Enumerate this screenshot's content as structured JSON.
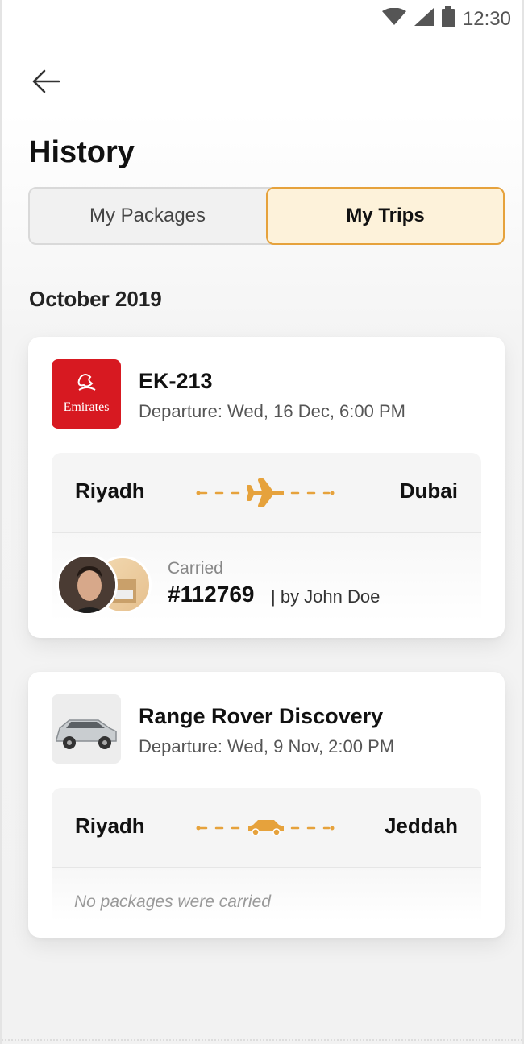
{
  "status_bar": {
    "time": "12:30",
    "icons": [
      "wifi-icon",
      "signal-icon",
      "battery-icon"
    ]
  },
  "header": {
    "back_icon": "arrow-left-icon",
    "title": "History"
  },
  "tabs": [
    {
      "label": "My Packages",
      "active": false
    },
    {
      "label": "My Trips",
      "active": true
    }
  ],
  "section": {
    "month": "October 2019"
  },
  "trips": [
    {
      "kind": "flight",
      "thumbnail": "emirates-logo",
      "logo_text": "Emirates",
      "title": "EK-213",
      "departure": "Departure: Wed, 16 Dec, 6:00 PM",
      "from": "Riyadh",
      "to": "Dubai",
      "route_icon": "airplane-icon",
      "carried_label": "Carried",
      "package_id": "#112769",
      "carrier": "| by John Doe"
    },
    {
      "kind": "car",
      "thumbnail": "car-photo",
      "title": "Range Rover Discovery",
      "departure": "Departure: Wed, 9 Nov, 2:00 PM",
      "from": "Riyadh",
      "to": "Jeddah",
      "route_icon": "car-icon",
      "no_packages": "No packages were carried"
    }
  ],
  "colors": {
    "accent": "#e6a23c",
    "emirates_red": "#d71921",
    "active_tab_bg": "#fdf2da"
  }
}
